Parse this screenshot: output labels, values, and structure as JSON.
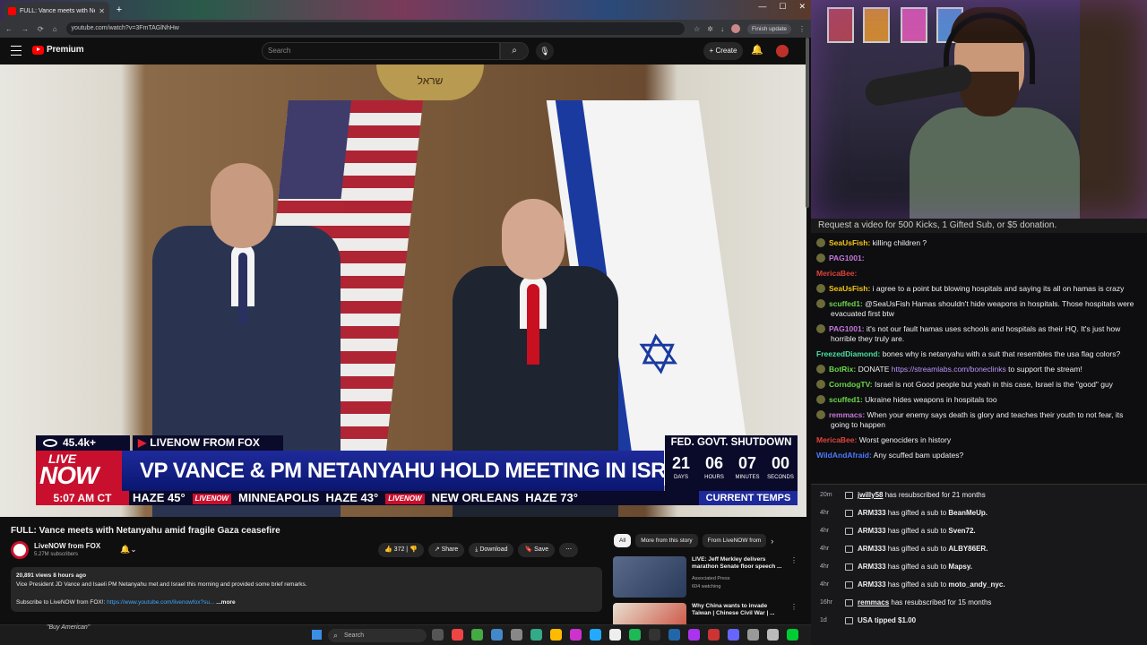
{
  "browser": {
    "tab_title": "FULL: Vance meets with Netany",
    "url": "youtube.com/watch?v=3FmTAGlNhHw",
    "finish_update": "Finish update"
  },
  "youtube": {
    "logo_text": "Premium",
    "search_placeholder": "Search",
    "create_label": "+ Create"
  },
  "broadcast": {
    "views": "45.4k+",
    "source": "LIVENOW FROM FOX",
    "shutdown": "FED. GOVT. SHUTDOWN",
    "live": "LIVE",
    "now": "NOW",
    "headline": "VP VANCE & PM NETANYAHU HOLD MEETING IN ISRAEL",
    "clock": [
      {
        "n": "21",
        "u": "DAYS"
      },
      {
        "n": "06",
        "u": "HOURS"
      },
      {
        "n": "07",
        "u": "MINUTES"
      },
      {
        "n": "00",
        "u": "SECONDS"
      }
    ],
    "time": "5:07 AM CT",
    "weather_1": "HAZE 45°",
    "weather_2": "MINNEAPOLIS",
    "weather_3": "HAZE 43°",
    "weather_4": "NEW ORLEANS",
    "weather_5": "HAZE 73°",
    "livenow_tag": "LIVENOW",
    "current_temps": "CURRENT TEMPS"
  },
  "video": {
    "title": "FULL: Vance meets with Netanyahu amid fragile Gaza ceasefire",
    "channel": "LiveNOW from FOX",
    "subs": "5.27M subscribers",
    "likes": "372",
    "share": "Share",
    "download": "Download",
    "save": "Save",
    "desc_meta": "20,891 views  8 hours ago",
    "desc_line": "Vice President JD Vance and Isaeli PM Netanyahu met and Israel this morning and provided some brief remarks.",
    "desc_sub": "Subscribe to LiveNOW from FOX!: ",
    "desc_link": "https://www.youtube.com/livenowfox?su...",
    "desc_more": "...more"
  },
  "chips": [
    "All",
    "More from this story",
    "From LiveNOW from"
  ],
  "recs": [
    {
      "title": "LIVE: Jeff Merkley delivers marathon Senate floor speech ...",
      "channel": "Associated Press",
      "meta": "604 watching"
    },
    {
      "title": "Why China wants to invade Taiwan | Chinese Civil War | ..."
    }
  ],
  "taskbar": {
    "search": "Search"
  },
  "stream": {
    "request": "Request a video for 500 Kicks, 1 Gifted Sub, or $5 donation."
  },
  "chat": [
    {
      "user": "SeaUsFish:",
      "color": "#f5c518",
      "text": " killing children ?"
    },
    {
      "user": "PAG1001:",
      "color": "#c678dd",
      "text": " "
    },
    {
      "user": "MericaBee:",
      "color": "#e0443a",
      "text": " ",
      "noicon": true
    },
    {
      "user": "SeaUsFish:",
      "color": "#f5c518",
      "text": " i agree to a point but blowing hospitals and saying its all on hamas is crazy"
    },
    {
      "user": "scuffed1:",
      "color": "#6cd84a",
      "text": " @SeaUsFish Hamas shouldn't hide weapons in hospitals. Those hospitals were evacuated first btw"
    },
    {
      "user": "PAG1001:",
      "color": "#c678dd",
      "text": " it's not our fault hamas uses schools and hospitals as their HQ. It's just how horrible they truly are."
    },
    {
      "user": "FreezedDiamond:",
      "color": "#4ae0a0",
      "text": " bones why is netanyahu with a suit that resembles the usa flag colors?",
      "noicon": true
    },
    {
      "user": "BotRix:",
      "color": "#6cd84a",
      "text": " DONATE ",
      "link": "https://streamlabs.com/boneclinks",
      "after": " to support the stream!"
    },
    {
      "user": "CorndogTV:",
      "color": "#6cd84a",
      "text": " Israel is not Good people but yeah in this case, Israel is the \"good\" guy"
    },
    {
      "user": "scuffed1:",
      "color": "#6cd84a",
      "text": " Ukraine hides weapons in hospitals too"
    },
    {
      "user": "remmacs:",
      "color": "#c678dd",
      "text": " When your enemy says death is glory and teaches their youth to not fear, its going to happen"
    },
    {
      "user": "MericaBee:",
      "color": "#e0443a",
      "text": " Worst genociders in history",
      "noicon": true
    },
    {
      "user": "WildAndAfraid:",
      "color": "#4a7aff",
      "text": " Any scuffed bam updates?",
      "noicon": true
    }
  ],
  "events": [
    {
      "t": "20m",
      "u": "jwilly58",
      "txt": " has resubscribed for 21 months",
      "underline": true
    },
    {
      "t": "4hr",
      "u": "ARM333",
      "txt": " has gifted a sub to ",
      "to": "BeanMeUp."
    },
    {
      "t": "4hr",
      "u": "ARM333",
      "txt": " has gifted a sub to ",
      "to": "Sven72."
    },
    {
      "t": "4hr",
      "u": "ARM333",
      "txt": " has gifted a sub to ",
      "to": "ALBY86ER."
    },
    {
      "t": "4hr",
      "u": "ARM333",
      "txt": " has gifted a sub to ",
      "to": "Mapsy."
    },
    {
      "t": "4hr",
      "u": "ARM333",
      "txt": " has gifted a sub to ",
      "to": "moto_andy_nyc."
    },
    {
      "t": "16hr",
      "u": "remmacs",
      "txt": " has resubscribed for 15 months",
      "underline": true
    },
    {
      "t": "1d",
      "u": "USA tipped ",
      "txt": "",
      "to": "$1.00",
      "tip": true
    }
  ],
  "event_note": "\"Buy American\"",
  "colors": {
    "yt_red": "#ff0000",
    "fox_red": "#c8102e",
    "fox_blue": "#1e2a9a",
    "twitch_bg": "#0e0e10"
  }
}
